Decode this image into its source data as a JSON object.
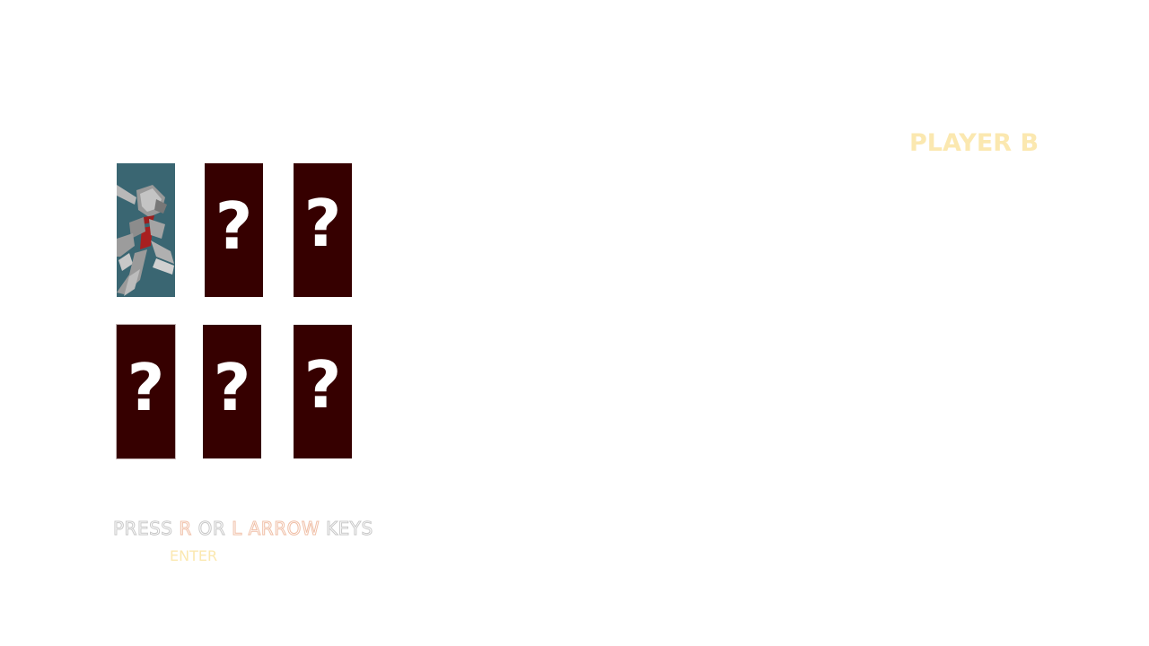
{
  "header": {
    "player_label": "PLAYER B",
    "player_label_color": "#fbe8b0"
  },
  "grid": {
    "card_back_color": "#360000",
    "revealed_card_color": "#3a6672",
    "cards": [
      {
        "id": 1,
        "state": "revealed",
        "icon": "robot-character-icon",
        "symbol": ""
      },
      {
        "id": 2,
        "state": "hidden",
        "symbol": "?"
      },
      {
        "id": 3,
        "state": "hidden",
        "symbol": "?"
      },
      {
        "id": 4,
        "state": "hidden",
        "symbol": "?"
      },
      {
        "id": 5,
        "state": "hidden",
        "symbol": "?"
      },
      {
        "id": 6,
        "state": "hidden",
        "symbol": "?"
      }
    ]
  },
  "instructions": {
    "press": "PRESS",
    "r_key": "R",
    "or": "OR",
    "l_arrow": "L ARROW",
    "keys": "KEYS",
    "enter": "ENTER"
  }
}
